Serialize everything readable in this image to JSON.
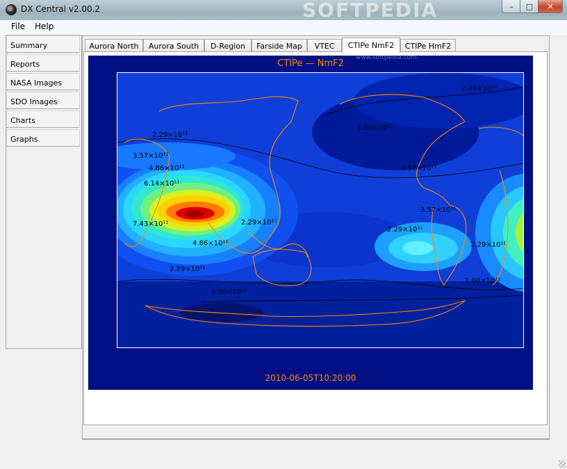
{
  "window": {
    "title": "DX Central  v2.00.2",
    "watermark": "SOFTPEDIA",
    "buttons": {
      "minimize": "–",
      "maximize": "□",
      "close": "✕"
    }
  },
  "menu": {
    "file": "File",
    "help": "Help"
  },
  "sidebar": {
    "items": [
      {
        "label": "Summary"
      },
      {
        "label": "Reports"
      },
      {
        "label": "NASA Images"
      },
      {
        "label": "SDO Images"
      },
      {
        "label": "Charts"
      },
      {
        "label": "Graphs"
      }
    ]
  },
  "tabs": [
    {
      "label": "Aurora North",
      "active": false
    },
    {
      "label": "Aurora South",
      "active": false
    },
    {
      "label": "D-Region",
      "active": false
    },
    {
      "label": "Farside Map",
      "active": false
    },
    {
      "label": "VTEC",
      "active": false
    },
    {
      "label": "CTIPe NmF2",
      "active": true
    },
    {
      "label": "CTIPe HmF2",
      "active": false
    }
  ],
  "map": {
    "title": "CTIPe — NmF2",
    "timestamp": "2010-06-05T10:20:00",
    "watermark_url": "www.softpedia.com",
    "contour_labels": [
      "2.29×10¹¹",
      "3.57×10¹¹",
      "4.86×10¹¹",
      "6.14×10¹¹",
      "7.43×10¹¹",
      "4.86×10¹¹",
      "2.29×10¹¹",
      "1.00×10¹¹",
      "2.29×10¹¹",
      "2.29×10¹¹",
      "3.57×10¹¹",
      "1.00×10¹¹",
      "2.29×10¹¹",
      "3.57×10¹¹",
      "1.00×10¹¹",
      "2.29×10¹¹"
    ],
    "colors": {
      "background": "#001084",
      "coastline": "#ff8800",
      "title": "#ff8800"
    }
  }
}
